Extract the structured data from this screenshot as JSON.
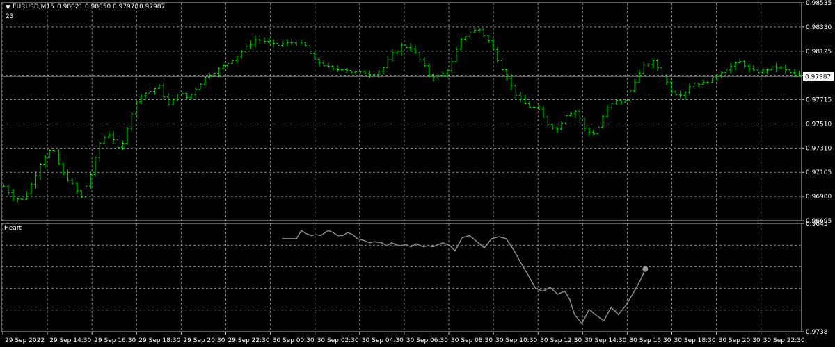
{
  "main_pane": {
    "symbol_label": "EURUSD,M15",
    "ohlc": [
      "0.98021",
      "0.98050",
      "0.97978",
      "0.97987"
    ],
    "sub_label": "23",
    "ylim": [
      0.96695,
      0.98645
    ],
    "y_ticks": [
      "0.98535",
      "0.98330",
      "0.98125",
      "0.97920",
      "0.97715",
      "0.97510",
      "0.97310",
      "0.97105",
      "0.96900",
      "0.96695"
    ],
    "current_price": 0.97987,
    "current_price_label": "0.97987",
    "bar_color": "#00ff00",
    "grid_color": "#8a8a8a",
    "axis_color": "#c0c0c0"
  },
  "indicator_pane": {
    "name": "Heart",
    "ylim": [
      0.9738,
      0.9845
    ],
    "y_ticks": [
      "0.9845",
      "0.9738"
    ],
    "line_color": "#8a8a8a"
  },
  "x_labels": [
    "29 Sep 2022",
    "29 Sep 14:30",
    "29 Sep 16:30",
    "29 Sep 18:30",
    "29 Sep 20:30",
    "29 Sep 22:30",
    "30 Sep 00:30",
    "30 Sep 02:30",
    "30 Sep 04:30",
    "30 Sep 06:30",
    "30 Sep 08:30",
    "30 Sep 10:30",
    "30 Sep 12:30",
    "30 Sep 14:30",
    "30 Sep 16:30",
    "30 Sep 18:30",
    "30 Sep 20:30",
    "30 Sep 22:30"
  ],
  "chart_data": [
    {
      "type": "ohlc",
      "bar_count": 175,
      "close_path": [
        [
          0,
          0.97
        ],
        [
          4,
          0.969
        ],
        [
          8,
          0.9688
        ],
        [
          12,
          0.9705
        ],
        [
          16,
          0.9725
        ],
        [
          20,
          0.9735
        ],
        [
          24,
          0.9712
        ],
        [
          28,
          0.9703
        ],
        [
          32,
          0.969
        ],
        [
          36,
          0.9712
        ],
        [
          40,
          0.9742
        ],
        [
          44,
          0.9748
        ],
        [
          48,
          0.973
        ],
        [
          52,
          0.9762
        ],
        [
          56,
          0.9782
        ],
        [
          60,
          0.9785
        ],
        [
          64,
          0.979
        ],
        [
          68,
          0.9772
        ],
        [
          72,
          0.9785
        ],
        [
          76,
          0.9779
        ],
        [
          80,
          0.979
        ],
        [
          84,
          0.98
        ],
        [
          88,
          0.9804
        ],
        [
          92,
          0.981
        ],
        [
          96,
          0.9817
        ],
        [
          100,
          0.9825
        ],
        [
          104,
          0.9832
        ],
        [
          108,
          0.983
        ],
        [
          112,
          0.9826
        ],
        [
          116,
          0.9828
        ],
        [
          120,
          0.9829
        ],
        [
          124,
          0.9827
        ],
        [
          128,
          0.9813
        ],
        [
          132,
          0.9809
        ],
        [
          136,
          0.9804
        ],
        [
          140,
          0.9806
        ],
        [
          144,
          0.9802
        ],
        [
          148,
          0.9802
        ],
        [
          152,
          0.9801
        ],
        [
          156,
          0.9805
        ],
        [
          160,
          0.9818
        ],
        [
          164,
          0.9826
        ],
        [
          168,
          0.9824
        ],
        [
          172,
          0.9812
        ],
        [
          176,
          0.9798
        ],
        [
          180,
          0.9799
        ],
        [
          184,
          0.9807
        ],
        [
          188,
          0.983
        ],
        [
          192,
          0.9838
        ],
        [
          196,
          0.9841
        ],
        [
          200,
          0.983
        ],
        [
          204,
          0.9812
        ],
        [
          208,
          0.9795
        ],
        [
          212,
          0.9779
        ],
        [
          216,
          0.9772
        ],
        [
          220,
          0.977
        ],
        [
          224,
          0.9757
        ],
        [
          228,
          0.9751
        ],
        [
          232,
          0.9765
        ],
        [
          236,
          0.9768
        ],
        [
          240,
          0.9749
        ],
        [
          244,
          0.9748
        ],
        [
          248,
          0.9768
        ],
        [
          252,
          0.9777
        ],
        [
          256,
          0.9775
        ],
        [
          260,
          0.9794
        ],
        [
          264,
          0.9808
        ],
        [
          268,
          0.9812
        ],
        [
          272,
          0.9798
        ],
        [
          276,
          0.9783
        ],
        [
          280,
          0.9783
        ],
        [
          284,
          0.9793
        ],
        [
          288,
          0.9792
        ],
        [
          292,
          0.9796
        ],
        [
          296,
          0.9803
        ],
        [
          300,
          0.9808
        ],
        [
          304,
          0.9812
        ],
        [
          308,
          0.9803
        ],
        [
          312,
          0.9803
        ],
        [
          316,
          0.9806
        ],
        [
          320,
          0.9807
        ],
        [
          324,
          0.9802
        ],
        [
          328,
          0.9799
        ]
      ]
    },
    {
      "type": "line",
      "series_points": [
        [
          114,
          0.983
        ],
        [
          118,
          0.983
        ],
        [
          120,
          0.983
        ],
        [
          122,
          0.9838
        ],
        [
          124,
          0.9835
        ],
        [
          126,
          0.9833
        ],
        [
          128,
          0.9834
        ],
        [
          130,
          0.9833
        ],
        [
          133,
          0.9838
        ],
        [
          135,
          0.9836
        ],
        [
          137,
          0.9833
        ],
        [
          139,
          0.9833
        ],
        [
          141,
          0.9836
        ],
        [
          143,
          0.9834
        ],
        [
          145,
          0.983
        ],
        [
          148,
          0.9828
        ],
        [
          150,
          0.9826
        ],
        [
          152,
          0.9827
        ],
        [
          155,
          0.9826
        ],
        [
          157,
          0.9823
        ],
        [
          159,
          0.9826
        ],
        [
          162,
          0.9823
        ],
        [
          165,
          0.9824
        ],
        [
          167,
          0.9822
        ],
        [
          169,
          0.9825
        ],
        [
          172,
          0.9822
        ],
        [
          174,
          0.9823
        ],
        [
          176,
          0.9822
        ],
        [
          180,
          0.9826
        ],
        [
          183,
          0.9823
        ],
        [
          185,
          0.9818
        ],
        [
          188,
          0.9831
        ],
        [
          191,
          0.9833
        ],
        [
          194,
          0.9827
        ],
        [
          197,
          0.9821
        ],
        [
          200,
          0.983
        ],
        [
          203,
          0.9832
        ],
        [
          206,
          0.983
        ],
        [
          209,
          0.9819
        ],
        [
          212,
          0.9806
        ],
        [
          215,
          0.9794
        ],
        [
          218,
          0.9781
        ],
        [
          221,
          0.9778
        ],
        [
          224,
          0.9782
        ],
        [
          227,
          0.9775
        ],
        [
          230,
          0.9778
        ],
        [
          232,
          0.977
        ],
        [
          234,
          0.9755
        ],
        [
          237,
          0.9746
        ],
        [
          240,
          0.976
        ],
        [
          243,
          0.9754
        ],
        [
          246,
          0.9749
        ],
        [
          249,
          0.9762
        ],
        [
          252,
          0.9755
        ],
        [
          255,
          0.9764
        ],
        [
          258,
          0.9776
        ],
        [
          261,
          0.9789
        ],
        [
          263,
          0.98
        ]
      ],
      "endpoint_marker": true
    }
  ]
}
